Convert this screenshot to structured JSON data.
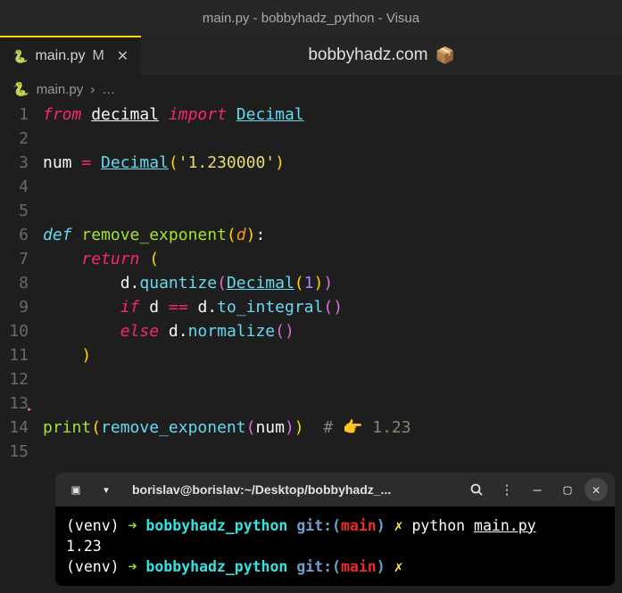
{
  "window": {
    "title": "main.py - bobbyhadz_python - Visua"
  },
  "tab": {
    "filename": "main.py",
    "modified_marker": "M"
  },
  "annotation": {
    "text": "bobbyhadz.com",
    "emoji": "📦"
  },
  "breadcrumb": {
    "file": "main.py",
    "sep": "›",
    "rest": "…"
  },
  "line_numbers": [
    "1",
    "2",
    "3",
    "4",
    "5",
    "6",
    "7",
    "8",
    "9",
    "10",
    "11",
    "12",
    "13",
    "14",
    "15"
  ],
  "code": {
    "l1": {
      "from": "from",
      "mod": "decimal",
      "import": "import",
      "cls": "Decimal"
    },
    "l3": {
      "var": "num",
      "eq": "=",
      "cls": "Decimal",
      "str": "'1.230000'"
    },
    "l6": {
      "def": "def",
      "fn": "remove_exponent",
      "param": "d"
    },
    "l7": {
      "ret": "return"
    },
    "l8": {
      "d": "d",
      "dot": ".",
      "quantize": "quantize",
      "cls": "Decimal",
      "one": "1"
    },
    "l9": {
      "if": "if",
      "d": "d",
      "eq": "==",
      "d2": "d",
      "dot": ".",
      "to_int": "to_integral"
    },
    "l10": {
      "else": "else",
      "d": "d",
      "dot": ".",
      "norm": "normalize"
    },
    "l14": {
      "print": "print",
      "fn": "remove_exponent",
      "arg": "num",
      "comment": "# 👉️ 1.23"
    }
  },
  "terminal": {
    "title": "borislav@borislav:~/Desktop/bobbyhadz_...",
    "lines": [
      {
        "venv": "(venv)",
        "arrow": "➜",
        "dir": "bobbyhadz_python",
        "git": "git:(",
        "branch": "main",
        "gitend": ")",
        "dirty": "✗",
        "cmd": "python",
        "file": "main.py"
      },
      {
        "output": "1.23"
      },
      {
        "venv": "(venv)",
        "arrow": "➜",
        "dir": "bobbyhadz_python",
        "git": "git:(",
        "branch": "main",
        "gitend": ")",
        "dirty": "✗"
      }
    ]
  }
}
